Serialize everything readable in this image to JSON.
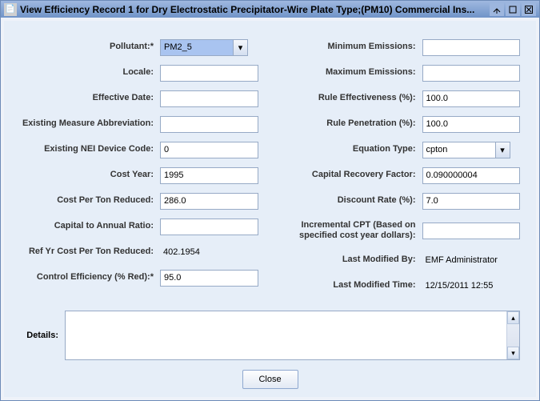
{
  "title": "View Efficiency Record 1 for Dry Electrostatic Precipitator-Wire Plate Type;(PM10) Commercial Ins...",
  "icon": "📄",
  "left": {
    "pollutant_label": "Pollutant:*",
    "pollutant_value": "PM2_5",
    "locale_label": "Locale:",
    "locale_value": "",
    "effective_date_label": "Effective Date:",
    "effective_date_value": "",
    "existing_measure_abbr_label": "Existing Measure Abbreviation:",
    "existing_measure_abbr_value": "",
    "existing_nei_device_code_label": "Existing NEI Device Code:",
    "existing_nei_device_code_value": "0",
    "cost_year_label": "Cost Year:",
    "cost_year_value": "1995",
    "cost_per_ton_reduced_label": "Cost Per Ton Reduced:",
    "cost_per_ton_reduced_value": "286.0",
    "capital_to_annual_ratio_label": "Capital to Annual Ratio:",
    "capital_to_annual_ratio_value": "",
    "ref_yr_cptr_label": "Ref Yr Cost Per Ton Reduced:",
    "ref_yr_cptr_value": "402.1954",
    "control_efficiency_label": "Control Efficiency (% Red):*",
    "control_efficiency_value": "95.0"
  },
  "right": {
    "minimum_emissions_label": "Minimum Emissions:",
    "minimum_emissions_value": "",
    "maximum_emissions_label": "Maximum Emissions:",
    "maximum_emissions_value": "",
    "rule_effectiveness_label": "Rule Effectiveness (%):",
    "rule_effectiveness_value": "100.0",
    "rule_penetration_label": "Rule Penetration (%):",
    "rule_penetration_value": "100.0",
    "equation_type_label": "Equation Type:",
    "equation_type_value": "cpton",
    "capital_recovery_factor_label": "Capital Recovery Factor:",
    "capital_recovery_factor_value": "0.090000004",
    "discount_rate_label": "Discount Rate (%):",
    "discount_rate_value": "7.0",
    "incremental_cpt_label": "Incremental CPT (Based on specified cost year dollars):",
    "incremental_cpt_value": "",
    "last_modified_by_label": "Last Modified By:",
    "last_modified_by_value": "EMF Administrator",
    "last_modified_time_label": "Last Modified Time:",
    "last_modified_time_value": "12/15/2011 12:55"
  },
  "details": {
    "label": "Details:",
    "value": ""
  },
  "buttons": {
    "close": "Close"
  }
}
